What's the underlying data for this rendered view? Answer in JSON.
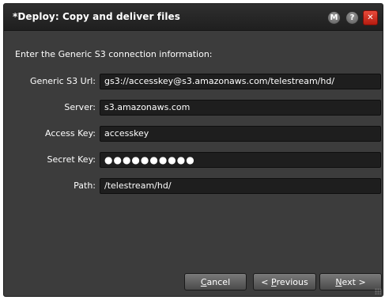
{
  "window": {
    "title": "*Deploy: Copy and deliver files",
    "buttons": {
      "m": "M",
      "help": "?",
      "close": "✕"
    }
  },
  "form": {
    "intro": "Enter the Generic S3 connection information:",
    "fields": [
      {
        "label": "Generic S3 Url:",
        "value": "gs3://accesskey@s3.amazonaws.com/telestream/hd/"
      },
      {
        "label": "Server:",
        "value": "s3.amazonaws.com"
      },
      {
        "label": "Access Key:",
        "value": "accesskey"
      },
      {
        "label": "Secret Key:",
        "value": "●●●●●●●●●●"
      },
      {
        "label": "Path:",
        "value": "/telestream/hd/"
      }
    ]
  },
  "footer": {
    "cancel": {
      "accel": "C",
      "rest": "ancel"
    },
    "previous": {
      "pre": "< ",
      "accel": "P",
      "rest": "revious"
    },
    "next": {
      "accel": "N",
      "rest": "ext >"
    }
  }
}
